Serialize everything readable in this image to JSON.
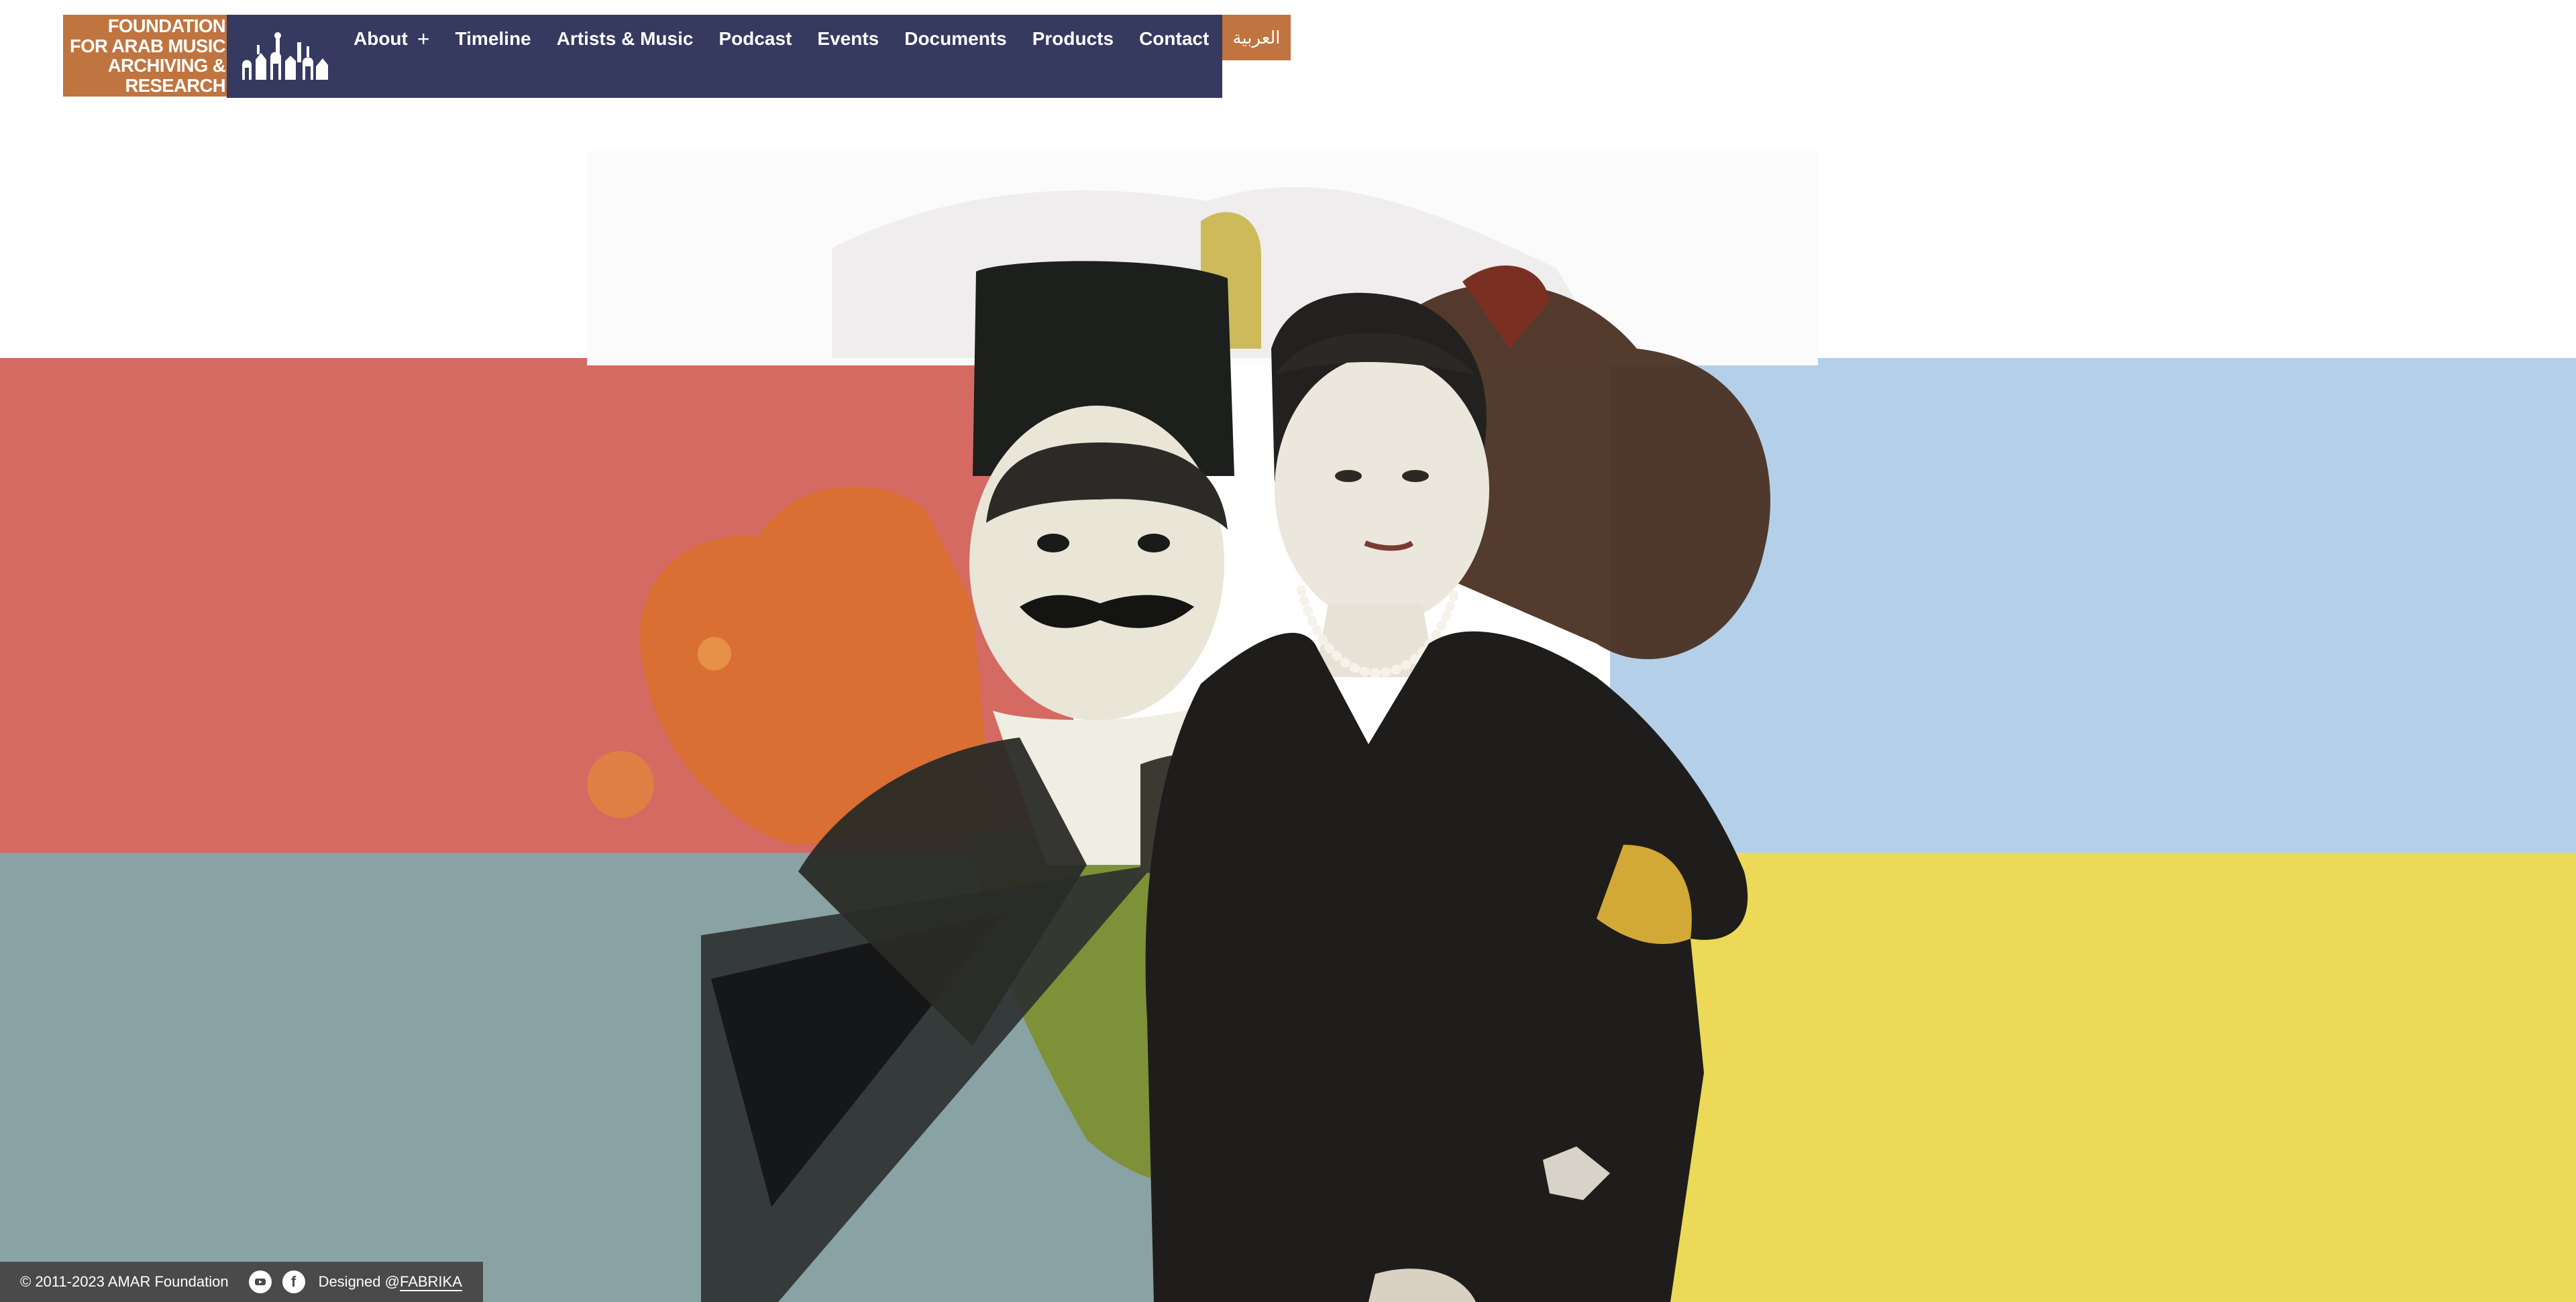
{
  "brand": {
    "lines": [
      "FOUNDATION",
      "FOR ARAB MUSIC",
      "ARCHIVING &",
      "RESEARCH"
    ],
    "mark_icon": "amar-skyline-logo-icon",
    "colors": {
      "orange": "#c0743f",
      "navy": "#363960"
    }
  },
  "nav": {
    "items": [
      {
        "label": "About",
        "suffix": "+"
      },
      {
        "label": "Timeline"
      },
      {
        "label": "Artists & Music"
      },
      {
        "label": "Podcast"
      },
      {
        "label": "Events"
      },
      {
        "label": "Documents"
      },
      {
        "label": "Products"
      },
      {
        "label": "Contact"
      }
    ],
    "language": "العربية"
  },
  "hero": {
    "image": "vintage-portrait-collage",
    "band_colors": {
      "red": "#d46a62",
      "blue": "#b4d0e8",
      "teal": "#89a2a4",
      "yellow": "#ebd957"
    }
  },
  "footer": {
    "copyright": "© 2011-2023 AMAR Foundation",
    "icons": [
      "youtube-icon",
      "facebook-icon"
    ],
    "designed_prefix": "Designed @",
    "designed_link": "FABRIKA"
  }
}
